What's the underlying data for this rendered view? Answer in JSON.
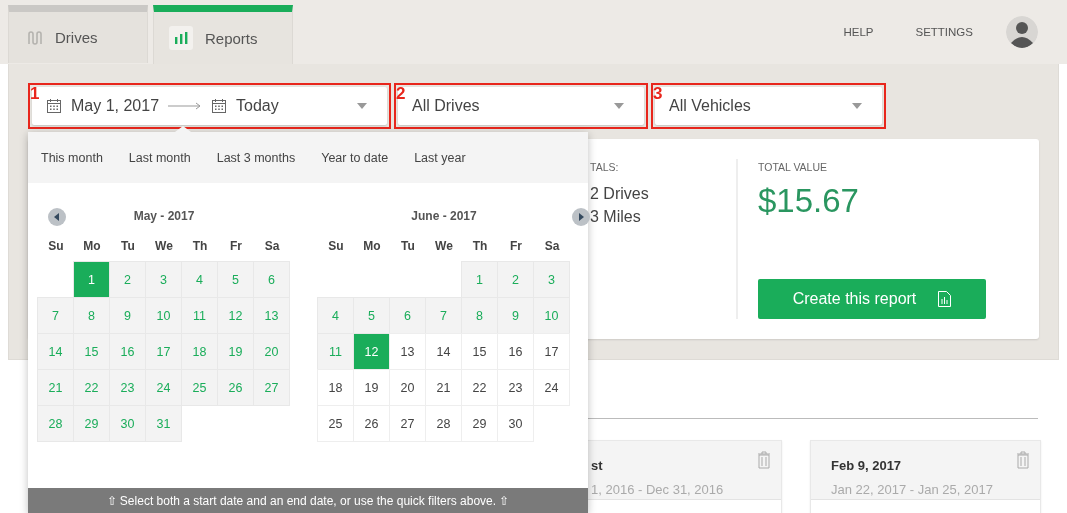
{
  "tabs": [
    {
      "label": "Drives",
      "selected": false
    },
    {
      "label": "Reports",
      "selected": true
    }
  ],
  "nav": [
    "HELP",
    "SETTINGS"
  ],
  "filters": [
    {
      "marker": "1",
      "kind": "date_range",
      "start": "May 1, 2017",
      "end": "Today"
    },
    {
      "marker": "2",
      "kind": "select",
      "value": "All Drives"
    },
    {
      "marker": "3",
      "kind": "select",
      "value": "All Vehicles"
    }
  ],
  "summary": {
    "totals_label": "TALS:",
    "totals": [
      "2 Drives",
      "3 Miles"
    ],
    "value_label": "TOTAL VALUE",
    "value": "$15.67",
    "button": "Create this report"
  },
  "reports": [
    {
      "title": "st",
      "dates": "1, 2016 - Dec 31, 2016"
    },
    {
      "title": "Feb 9, 2017",
      "dates": "Jan 22, 2017 - Jan 25, 2017"
    }
  ],
  "date_picker": {
    "quick_filters": [
      "This month",
      "Last month",
      "Last 3 months",
      "Year to date",
      "Last year"
    ],
    "months": [
      {
        "title": "May - 2017",
        "kind": "prev",
        "weekdays": [
          "Su",
          "Mo",
          "Tu",
          "We",
          "Th",
          "Fr",
          "Sa"
        ],
        "weeks": [
          {
            "kind": "end",
            "days": [
              {
                "label": "1",
                "selected": true,
                "in_range": true
              },
              {
                "label": "2",
                "selected": false,
                "in_range": true
              },
              {
                "label": "3",
                "selected": false,
                "in_range": true
              },
              {
                "label": "4",
                "selected": false,
                "in_range": true
              },
              {
                "label": "5",
                "selected": false,
                "in_range": true
              },
              {
                "label": "6",
                "selected": false,
                "in_range": true
              }
            ]
          },
          {
            "kind": "start",
            "days": [
              {
                "label": "7",
                "selected": false,
                "in_range": true
              },
              {
                "label": "8",
                "selected": false,
                "in_range": true
              },
              {
                "label": "9",
                "selected": false,
                "in_range": true
              },
              {
                "label": "10",
                "selected": false,
                "in_range": true
              },
              {
                "label": "11",
                "selected": false,
                "in_range": true
              },
              {
                "label": "12",
                "selected": false,
                "in_range": true
              },
              {
                "label": "13",
                "selected": false,
                "in_range": true
              }
            ]
          },
          {
            "kind": "start",
            "days": [
              {
                "label": "14",
                "selected": false,
                "in_range": true
              },
              {
                "label": "15",
                "selected": false,
                "in_range": true
              },
              {
                "label": "16",
                "selected": false,
                "in_range": true
              },
              {
                "label": "17",
                "selected": false,
                "in_range": true
              },
              {
                "label": "18",
                "selected": false,
                "in_range": true
              },
              {
                "label": "19",
                "selected": false,
                "in_range": true
              },
              {
                "label": "20",
                "selected": false,
                "in_range": true
              }
            ]
          },
          {
            "kind": "start",
            "days": [
              {
                "label": "21",
                "selected": false,
                "in_range": true
              },
              {
                "label": "22",
                "selected": false,
                "in_range": true
              },
              {
                "label": "23",
                "selected": false,
                "in_range": true
              },
              {
                "label": "24",
                "selected": false,
                "in_range": true
              },
              {
                "label": "25",
                "selected": false,
                "in_range": true
              },
              {
                "label": "26",
                "selected": false,
                "in_range": true
              },
              {
                "label": "27",
                "selected": false,
                "in_range": true
              }
            ]
          },
          {
            "kind": "start",
            "days": [
              {
                "label": "28",
                "selected": false,
                "in_range": true
              },
              {
                "label": "29",
                "selected": false,
                "in_range": true
              },
              {
                "label": "30",
                "selected": false,
                "in_range": true
              },
              {
                "label": "31",
                "selected": false,
                "in_range": true
              }
            ]
          }
        ]
      },
      {
        "title": "June - 2017",
        "kind": "next",
        "weekdays": [
          "Su",
          "Mo",
          "Tu",
          "We",
          "Th",
          "Fr",
          "Sa"
        ],
        "weeks": [
          {
            "kind": "end",
            "days": [
              {
                "label": "1",
                "selected": false,
                "in_range": true
              },
              {
                "label": "2",
                "selected": false,
                "in_range": true
              },
              {
                "label": "3",
                "selected": false,
                "in_range": true
              }
            ]
          },
          {
            "kind": "start",
            "days": [
              {
                "label": "4",
                "selected": false,
                "in_range": true
              },
              {
                "label": "5",
                "selected": false,
                "in_range": true
              },
              {
                "label": "6",
                "selected": false,
                "in_range": true
              },
              {
                "label": "7",
                "selected": false,
                "in_range": true
              },
              {
                "label": "8",
                "selected": false,
                "in_range": true
              },
              {
                "label": "9",
                "selected": false,
                "in_range": true
              },
              {
                "label": "10",
                "selected": false,
                "in_range": true
              }
            ]
          },
          {
            "kind": "start",
            "days": [
              {
                "label": "11",
                "selected": false,
                "in_range": true
              },
              {
                "label": "12",
                "selected": true,
                "in_range": true
              },
              {
                "label": "13",
                "selected": false,
                "in_range": false
              },
              {
                "label": "14",
                "selected": false,
                "in_range": false
              },
              {
                "label": "15",
                "selected": false,
                "in_range": false
              },
              {
                "label": "16",
                "selected": false,
                "in_range": false
              },
              {
                "label": "17",
                "selected": false,
                "in_range": false
              }
            ]
          },
          {
            "kind": "start",
            "days": [
              {
                "label": "18",
                "selected": false,
                "in_range": false
              },
              {
                "label": "19",
                "selected": false,
                "in_range": false
              },
              {
                "label": "20",
                "selected": false,
                "in_range": false
              },
              {
                "label": "21",
                "selected": false,
                "in_range": false
              },
              {
                "label": "22",
                "selected": false,
                "in_range": false
              },
              {
                "label": "23",
                "selected": false,
                "in_range": false
              },
              {
                "label": "24",
                "selected": false,
                "in_range": false
              }
            ]
          },
          {
            "kind": "start",
            "days": [
              {
                "label": "25",
                "selected": false,
                "in_range": false
              },
              {
                "label": "26",
                "selected": false,
                "in_range": false
              },
              {
                "label": "27",
                "selected": false,
                "in_range": false
              },
              {
                "label": "28",
                "selected": false,
                "in_range": false
              },
              {
                "label": "29",
                "selected": false,
                "in_range": false
              },
              {
                "label": "30",
                "selected": false,
                "in_range": false
              }
            ]
          }
        ]
      }
    ],
    "hint": "⇧ Select both a start date and an end date, or use the quick filters above. ⇧"
  }
}
